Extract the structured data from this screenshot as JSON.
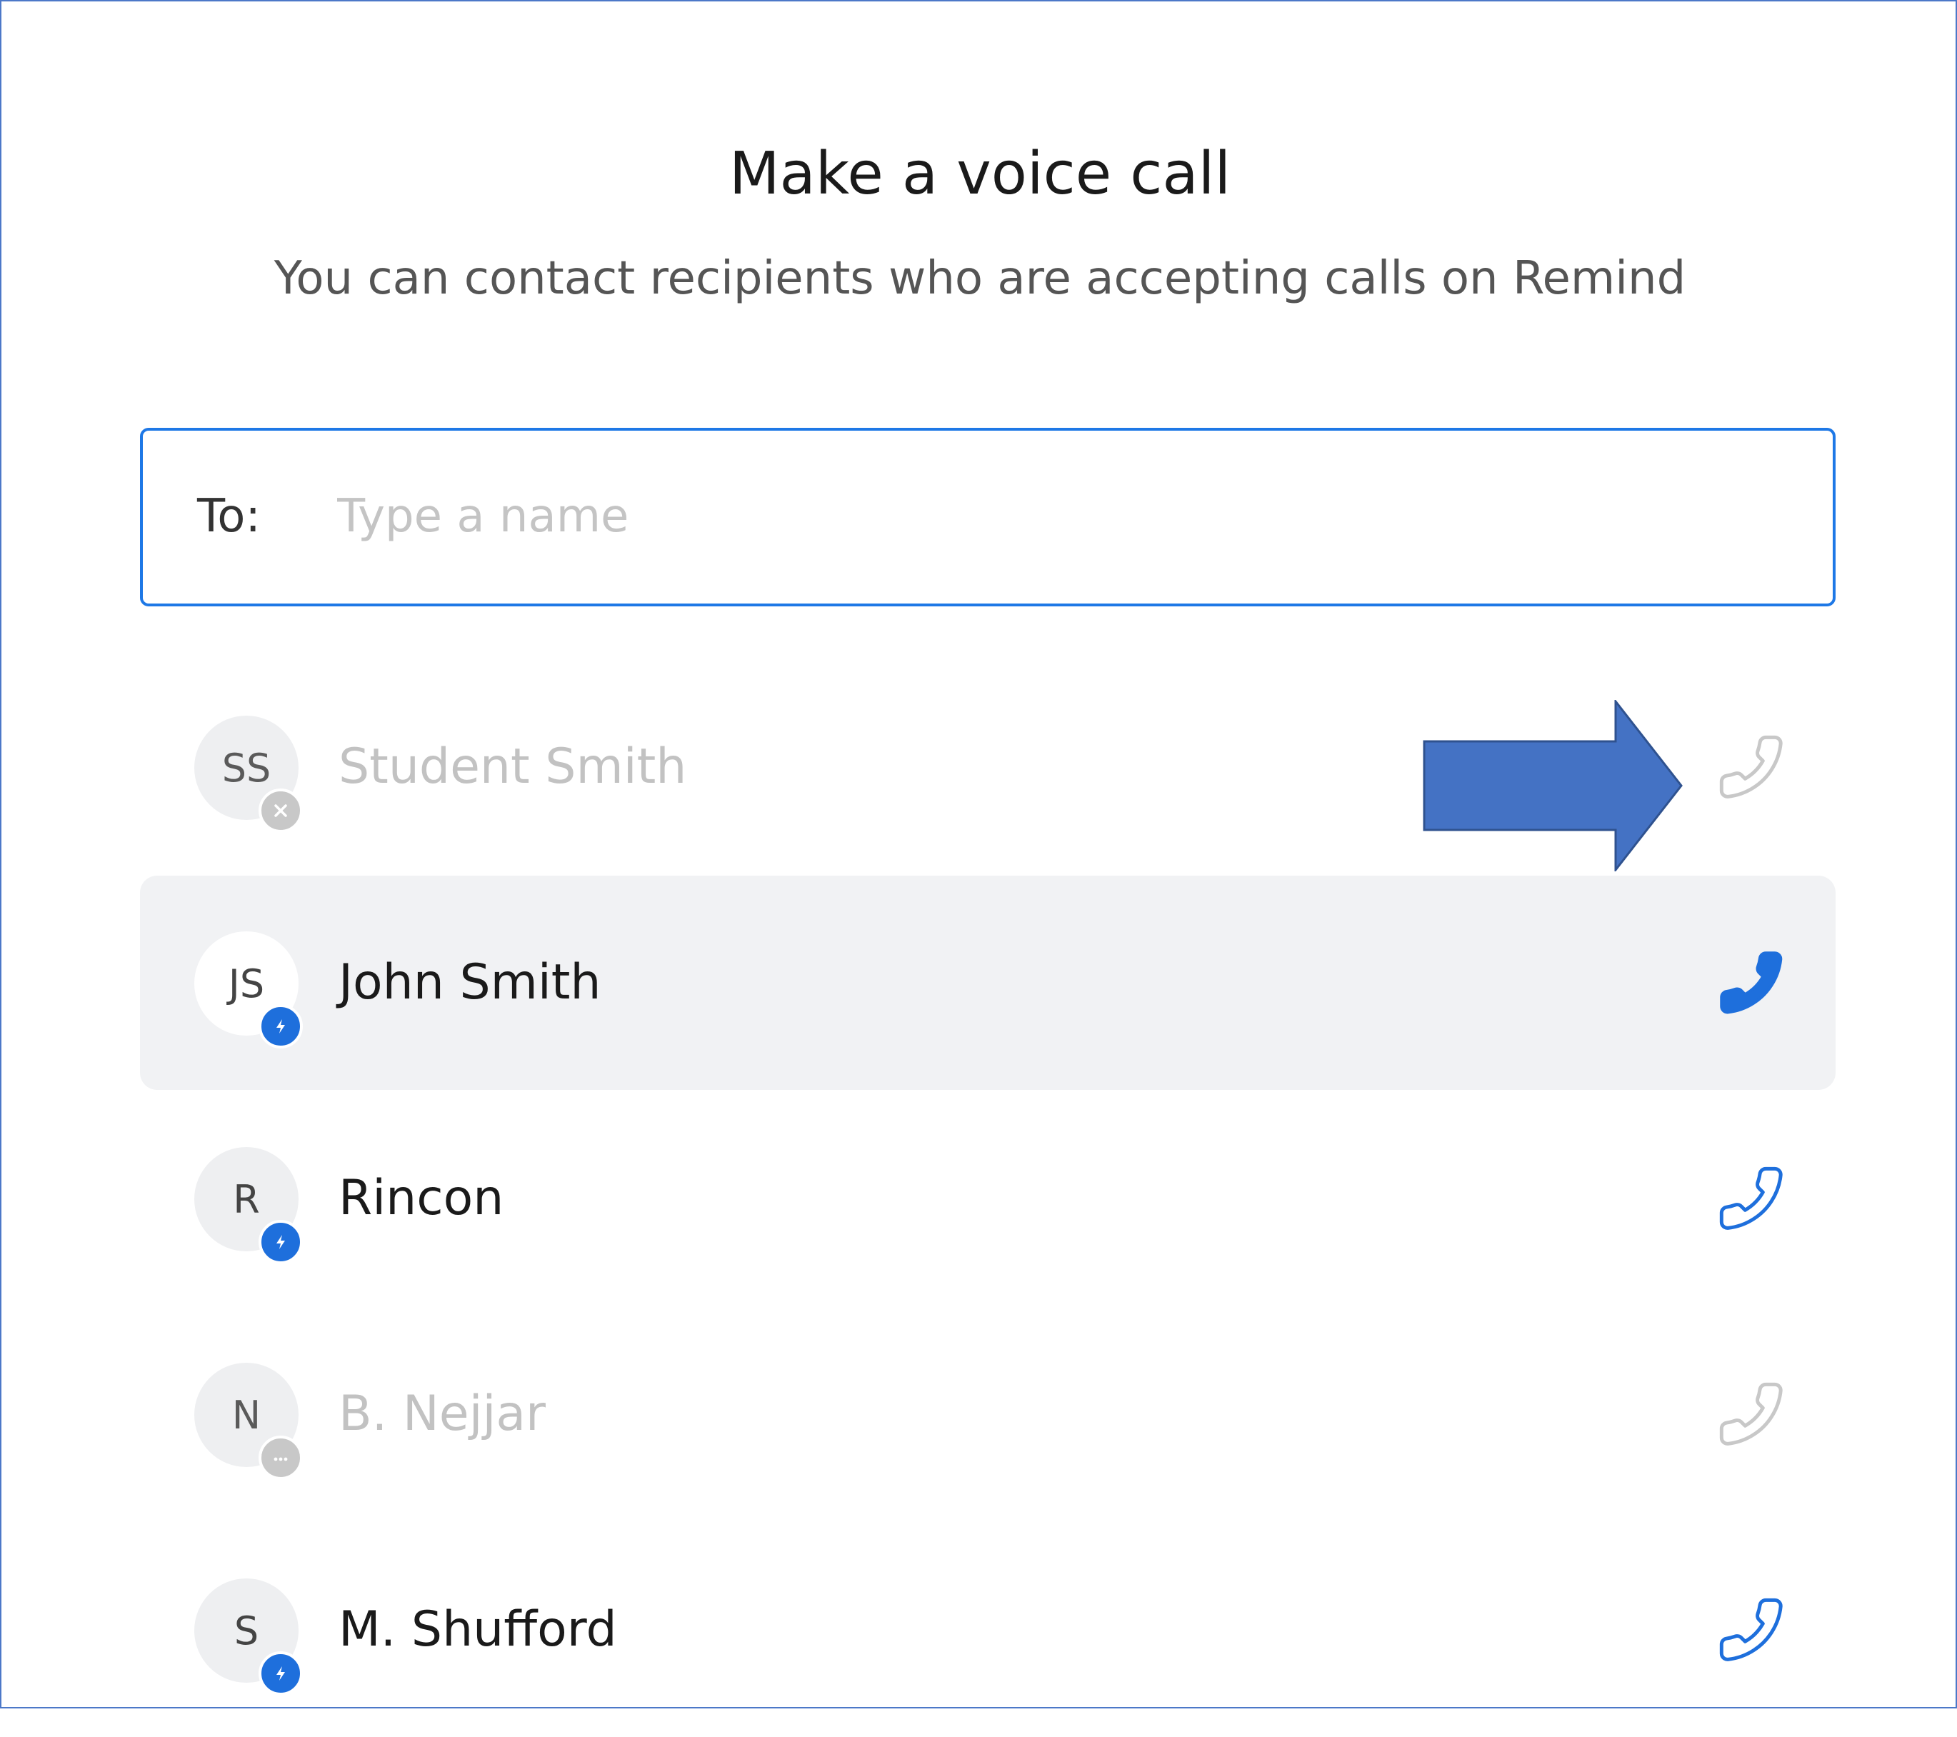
{
  "dialog": {
    "title": "Make a voice call",
    "subtitle": "You can contact recipients who are accepting calls on Remind"
  },
  "to_field": {
    "label": "To:",
    "placeholder": "Type a name",
    "value": ""
  },
  "recipients": [
    {
      "initials": "SS",
      "name": "Student Smith",
      "status": "unavailable",
      "badge_icon": "close-icon",
      "call_icon": "phone-outline-icon",
      "call_enabled": false
    },
    {
      "initials": "JS",
      "name": "John Smith",
      "status": "available",
      "badge_icon": "bolt-icon",
      "call_icon": "phone-filled-icon",
      "call_enabled": true,
      "hovered": true
    },
    {
      "initials": "R",
      "name": "Rincon",
      "status": "available",
      "badge_icon": "bolt-icon",
      "call_icon": "phone-outline-icon",
      "call_enabled": true
    },
    {
      "initials": "N",
      "name": "B. Nejjar",
      "status": "pending",
      "badge_icon": "ellipsis-icon",
      "call_icon": "phone-outline-icon",
      "call_enabled": false
    },
    {
      "initials": "S",
      "name": "M. Shufford",
      "status": "available",
      "badge_icon": "bolt-icon",
      "call_icon": "phone-outline-icon",
      "call_enabled": true
    }
  ],
  "annotation": {
    "shape": "right-arrow",
    "color": "#4472c4",
    "points_to": "call-button-student-smith"
  },
  "colors": {
    "accent": "#1e78e6",
    "badge_blue": "#1e6fdc",
    "disabled": "#c2c2c2",
    "hover_row": "#f1f2f4"
  }
}
